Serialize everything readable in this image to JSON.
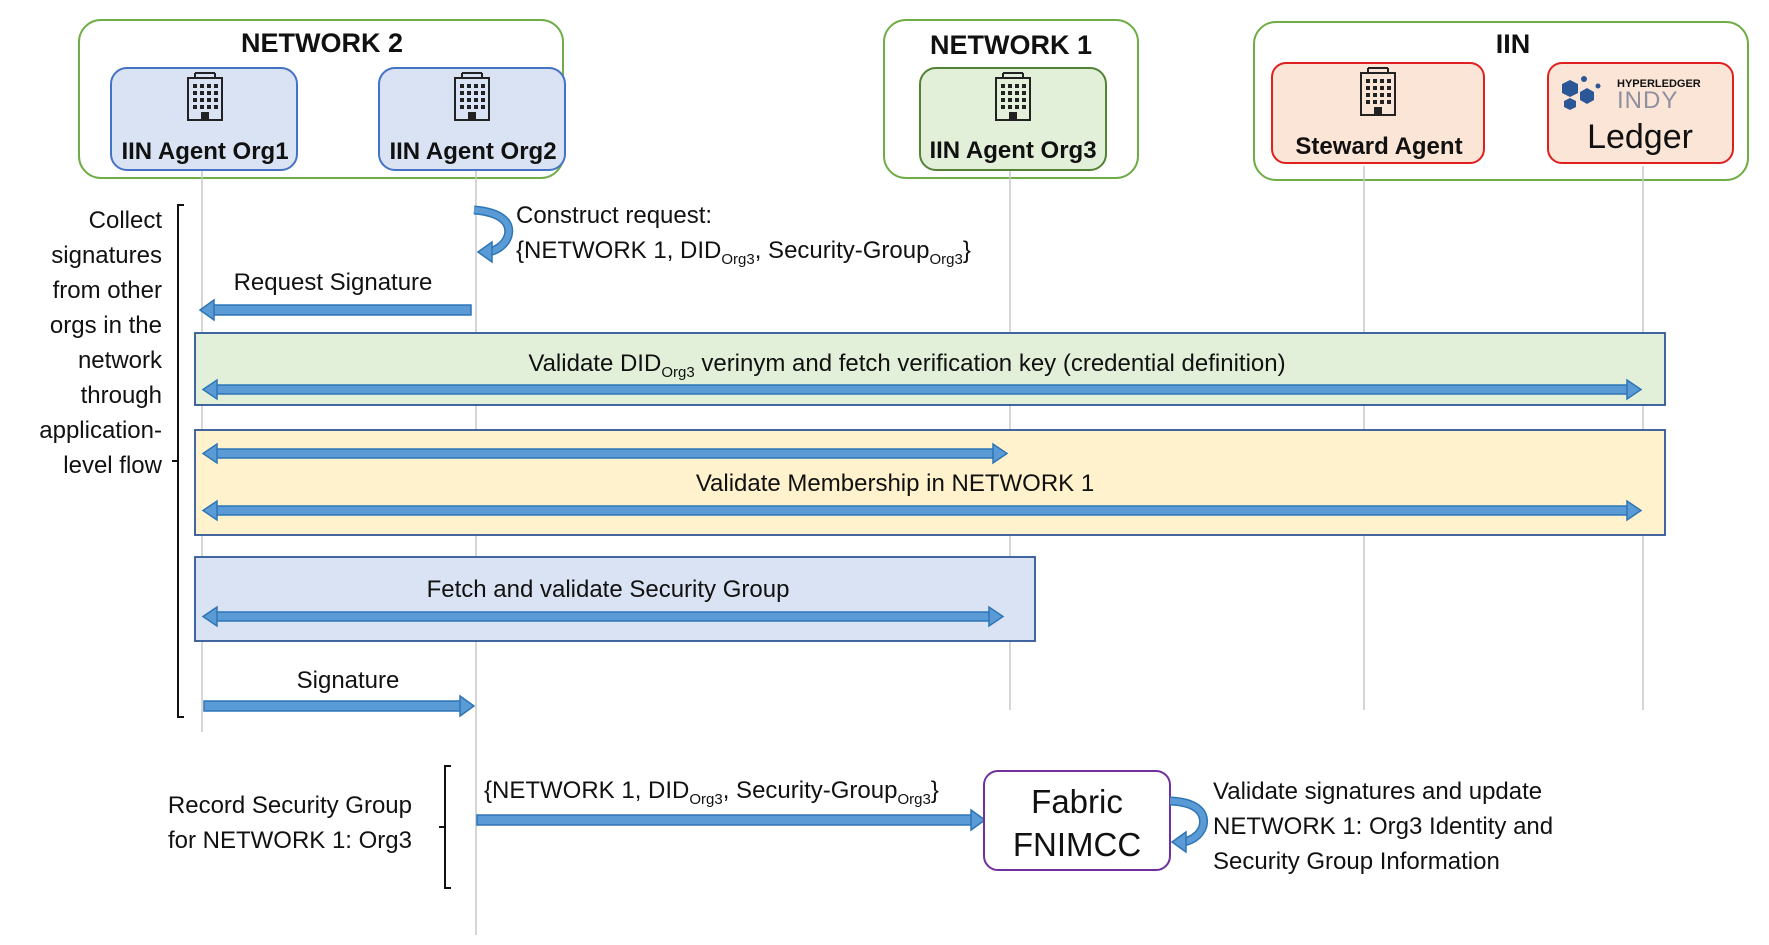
{
  "groups": {
    "network2": {
      "title": "NETWORK 2"
    },
    "network1": {
      "title": "NETWORK 1"
    },
    "iin": {
      "title": "IIN"
    }
  },
  "participants": {
    "org1": {
      "label": "IIN Agent Org1",
      "icon": "building-icon"
    },
    "org2": {
      "label": "IIN Agent Org2",
      "icon": "building-icon"
    },
    "org3": {
      "label": "IIN Agent Org3",
      "icon": "building-icon"
    },
    "steward": {
      "label": "Steward Agent",
      "icon": "building-icon"
    },
    "ledger": {
      "logo_top": "HYPERLEDGER",
      "logo_bottom": "INDY",
      "label": "Ledger"
    }
  },
  "left_note": {
    "lines": [
      "Collect",
      "signatures",
      "from other",
      "orgs in the",
      "network",
      "through",
      "application-",
      "level flow"
    ]
  },
  "construct": {
    "line1": "Construct request:",
    "line2": {
      "a": "{NETWORK 1, DID",
      "sub1": "Org3",
      "b": ", Security-Group",
      "sub2": "Org3",
      "c": "}"
    }
  },
  "messages": {
    "request_signature": "Request Signature",
    "validate_did": {
      "a": "Validate DID",
      "sub": "Org3",
      "b": " verinym and fetch verification key (credential definition)"
    },
    "validate_membership": "Validate Membership in NETWORK 1",
    "fetch_security_group": "Fetch and validate Security Group",
    "signature": "Signature"
  },
  "record": {
    "lines": [
      "Record Security Group",
      "for NETWORK 1: Org3"
    ],
    "message": {
      "a": "{NETWORK 1, DID",
      "sub1": "Org3",
      "b": ", Security-Group",
      "sub2": "Org3",
      "c": "}"
    }
  },
  "fnimcc": {
    "line1": "Fabric",
    "line2": "FNIMCC"
  },
  "final_note": {
    "lines": [
      "Validate signatures and update",
      "NETWORK 1: Org3 Identity and",
      "Security Group Information"
    ]
  },
  "colors": {
    "group_border": "#70ad47",
    "blue_fill": "#dae3f3",
    "blue_border": "#4472c4",
    "green_fill": "#e2f0d9",
    "green_border": "#548235",
    "red_fill": "#fbe5d6",
    "red_border": "#e02020",
    "arrow": "#5b9bd5",
    "arrow_border": "#2e75b6",
    "band_border": "#2f5597",
    "band_green": "#e2f0d9",
    "band_yellow": "#fff2cc",
    "band_blue": "#dae3f3",
    "fnimcc_border": "#7030a0",
    "lifeline": "#c8c8c8",
    "indy_logo": "#2b5797"
  }
}
